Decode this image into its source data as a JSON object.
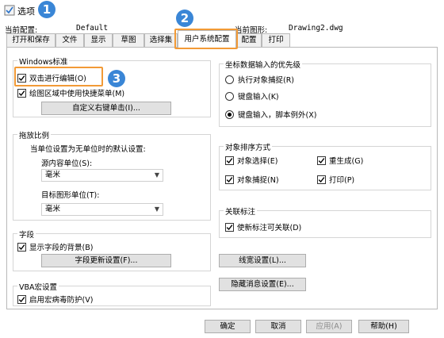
{
  "window": {
    "title": "选项",
    "icon": "app-options-icon"
  },
  "config": {
    "current_profile_label": "当前配置:",
    "current_profile_value": "Default",
    "current_drawing_label": "当前图形:",
    "current_drawing_value": "Drawing2.dwg"
  },
  "tabs": [
    {
      "label": "打开和保存"
    },
    {
      "label": "文件"
    },
    {
      "label": "显示"
    },
    {
      "label": "草图"
    },
    {
      "label": "选择集"
    },
    {
      "label": "用户系统配置",
      "active": true
    },
    {
      "label": "配置"
    },
    {
      "label": "打印"
    }
  ],
  "windows_std": {
    "title": "Windows标准",
    "dblclick_edit": {
      "label": "双击进行编辑(O)",
      "checked": true
    },
    "shortcut_menu": {
      "label": "绘图区域中使用快捷菜单(M)",
      "checked": true
    },
    "customize_right_click": "自定义右键单击(I)..."
  },
  "insertion_scale": {
    "title": "拖放比例",
    "desc": "当单位设置为无单位时的默认设置:",
    "source_label": "源内容单位(S):",
    "source_value": "毫米",
    "target_label": "目标图形单位(T):",
    "target_value": "毫米"
  },
  "fields": {
    "title": "字段",
    "show_bg": {
      "label": "显示字段的背景(B)",
      "checked": true
    },
    "update_settings": "字段更新设置(F)..."
  },
  "vba": {
    "title": "VBA宏设置",
    "virus_protect": {
      "label": "启用宏病毒防护(V)",
      "checked": true
    }
  },
  "coord_priority": {
    "title": "坐标数据输入的优先级",
    "options": [
      {
        "label": "执行对象捕捉(R)",
        "selected": false
      },
      {
        "label": "键盘输入(K)",
        "selected": false
      },
      {
        "label": "键盘输入，脚本例外(X)",
        "selected": true
      }
    ]
  },
  "draw_order": {
    "title": "对象排序方式",
    "obj_select": {
      "label": "对象选择(E)",
      "checked": true
    },
    "regen": {
      "label": "重生成(G)",
      "checked": true
    },
    "obj_snap": {
      "label": "对象捕捉(N)",
      "checked": true
    },
    "plot": {
      "label": "打印(P)",
      "checked": true
    }
  },
  "assoc_dim": {
    "title": "关联标注",
    "make_assoc": {
      "label": "使新标注可关联(D)",
      "checked": true
    }
  },
  "lineweight_btn": "线宽设置(L)...",
  "hidden_msg_btn": "隐藏消息设置(E)...",
  "footer": {
    "ok": "确定",
    "cancel": "取消",
    "apply": "应用(A)",
    "help": "帮助(H)"
  },
  "annotations": {
    "badge1": "1",
    "badge2": "2",
    "badge3": "3",
    "badge_color": "#3a86d6",
    "highlight_color": "#f29a36"
  }
}
